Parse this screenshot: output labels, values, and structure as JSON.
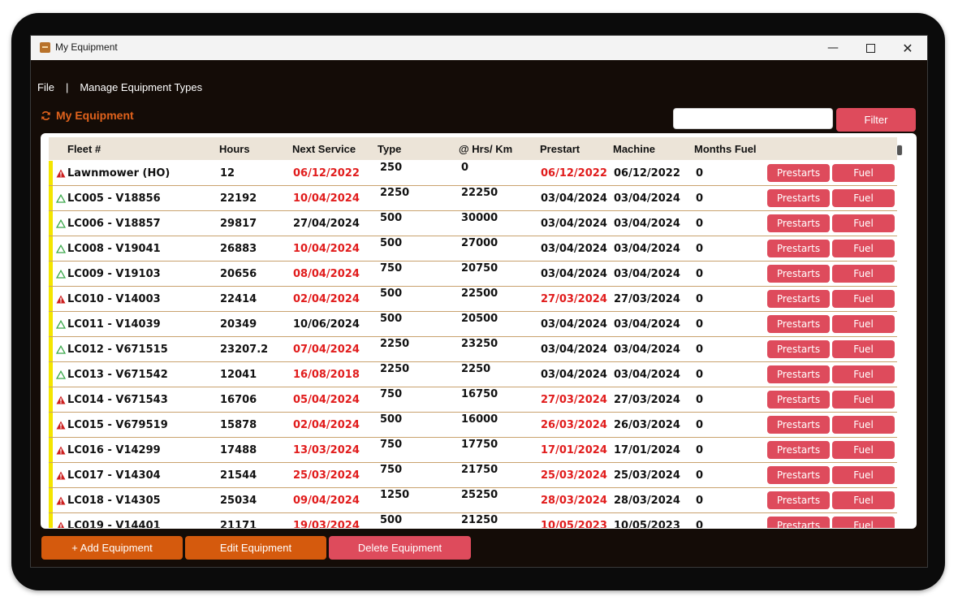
{
  "window": {
    "title": "My Equipment",
    "minimize": "—",
    "close": "✕"
  },
  "menu": {
    "file": "File",
    "separator": "|",
    "manage_types": "Manage Equipment Types"
  },
  "heading": "My Equipment",
  "filter": {
    "placeholder": "",
    "button": "Filter"
  },
  "table": {
    "columns": {
      "fleet": "Fleet #",
      "hours": "Hours",
      "next_service": "Next Service",
      "type": "Type",
      "at_hrs": "@ Hrs/ Km",
      "prestart": "Prestart",
      "machine": "Machine",
      "months_fuel": "Months Fuel"
    },
    "buttons": {
      "prestarts": "Prestarts",
      "fuel": "Fuel"
    },
    "rows": [
      {
        "status": "alert",
        "fleet": "Lawnmower (HO)",
        "hours": "12",
        "next_service": "06/12/2022",
        "next_service_overdue": true,
        "type": "250",
        "at_hrs": "0",
        "prestart": "06/12/2022",
        "prestart_overdue": true,
        "machine": "06/12/2022",
        "months_fuel": "0"
      },
      {
        "status": "ok",
        "fleet": "LC005 - V18856",
        "hours": "22192",
        "next_service": "10/04/2024",
        "next_service_overdue": true,
        "type": "2250",
        "at_hrs": "22250",
        "prestart": "03/04/2024",
        "prestart_overdue": false,
        "machine": "03/04/2024",
        "months_fuel": "0"
      },
      {
        "status": "ok",
        "fleet": "LC006 - V18857",
        "hours": "29817",
        "next_service": "27/04/2024",
        "next_service_overdue": false,
        "type": "500",
        "at_hrs": "30000",
        "prestart": "03/04/2024",
        "prestart_overdue": false,
        "machine": "03/04/2024",
        "months_fuel": "0"
      },
      {
        "status": "ok",
        "fleet": "LC008 - V19041",
        "hours": "26883",
        "next_service": "10/04/2024",
        "next_service_overdue": true,
        "type": "500",
        "at_hrs": "27000",
        "prestart": "03/04/2024",
        "prestart_overdue": false,
        "machine": "03/04/2024",
        "months_fuel": "0"
      },
      {
        "status": "ok",
        "fleet": "LC009 - V19103",
        "hours": "20656",
        "next_service": "08/04/2024",
        "next_service_overdue": true,
        "type": "750",
        "at_hrs": "20750",
        "prestart": "03/04/2024",
        "prestart_overdue": false,
        "machine": "03/04/2024",
        "months_fuel": "0"
      },
      {
        "status": "alert",
        "fleet": "LC010 - V14003",
        "hours": "22414",
        "next_service": "02/04/2024",
        "next_service_overdue": true,
        "type": "500",
        "at_hrs": "22500",
        "prestart": "27/03/2024",
        "prestart_overdue": true,
        "machine": "27/03/2024",
        "months_fuel": "0"
      },
      {
        "status": "ok",
        "fleet": "LC011 - V14039",
        "hours": "20349",
        "next_service": "10/06/2024",
        "next_service_overdue": false,
        "type": "500",
        "at_hrs": "20500",
        "prestart": "03/04/2024",
        "prestart_overdue": false,
        "machine": "03/04/2024",
        "months_fuel": "0"
      },
      {
        "status": "ok",
        "fleet": "LC012 - V671515",
        "hours": "23207.2",
        "next_service": "07/04/2024",
        "next_service_overdue": true,
        "type": "2250",
        "at_hrs": "23250",
        "prestart": "03/04/2024",
        "prestart_overdue": false,
        "machine": "03/04/2024",
        "months_fuel": "0"
      },
      {
        "status": "ok",
        "fleet": "LC013 - V671542",
        "hours": "12041",
        "next_service": "16/08/2018",
        "next_service_overdue": true,
        "type": "2250",
        "at_hrs": "2250",
        "prestart": "03/04/2024",
        "prestart_overdue": false,
        "machine": "03/04/2024",
        "months_fuel": "0"
      },
      {
        "status": "alert",
        "fleet": "LC014 - V671543",
        "hours": "16706",
        "next_service": "05/04/2024",
        "next_service_overdue": true,
        "type": "750",
        "at_hrs": "16750",
        "prestart": "27/03/2024",
        "prestart_overdue": true,
        "machine": "27/03/2024",
        "months_fuel": "0"
      },
      {
        "status": "alert",
        "fleet": "LC015 - V679519",
        "hours": "15878",
        "next_service": "02/04/2024",
        "next_service_overdue": true,
        "type": "500",
        "at_hrs": "16000",
        "prestart": "26/03/2024",
        "prestart_overdue": true,
        "machine": "26/03/2024",
        "months_fuel": "0"
      },
      {
        "status": "alert",
        "fleet": "LC016 - V14299",
        "hours": "17488",
        "next_service": "13/03/2024",
        "next_service_overdue": true,
        "type": "750",
        "at_hrs": "17750",
        "prestart": "17/01/2024",
        "prestart_overdue": true,
        "machine": "17/01/2024",
        "months_fuel": "0"
      },
      {
        "status": "alert",
        "fleet": "LC017 - V14304",
        "hours": "21544",
        "next_service": "25/03/2024",
        "next_service_overdue": true,
        "type": "750",
        "at_hrs": "21750",
        "prestart": "25/03/2024",
        "prestart_overdue": true,
        "machine": "25/03/2024",
        "months_fuel": "0"
      },
      {
        "status": "alert",
        "fleet": "LC018 - V14305",
        "hours": "25034",
        "next_service": "09/04/2024",
        "next_service_overdue": true,
        "type": "1250",
        "at_hrs": "25250",
        "prestart": "28/03/2024",
        "prestart_overdue": true,
        "machine": "28/03/2024",
        "months_fuel": "0"
      },
      {
        "status": "alert",
        "fleet": "LC019 - V14401",
        "hours": "21171",
        "next_service": "19/03/2024",
        "next_service_overdue": true,
        "type": "500",
        "at_hrs": "21250",
        "prestart": "10/05/2023",
        "prestart_overdue": true,
        "machine": "10/05/2023",
        "months_fuel": "0"
      }
    ]
  },
  "actions": {
    "add": "+ Add Equipment",
    "edit": "Edit Equipment",
    "delete": "Delete Equipment"
  },
  "colors": {
    "accent_orange": "#d55a0d",
    "accent_red": "#de4b5c",
    "overdue_text": "#e11c1c",
    "alert_icon": "#cc1f1f",
    "ok_icon": "#3aa84a",
    "row_marker": "#f4e500"
  },
  "icons": {
    "alert": "warning-triangle-red-icon",
    "ok": "warning-triangle-outline-green-icon",
    "refresh": "refresh-icon"
  }
}
